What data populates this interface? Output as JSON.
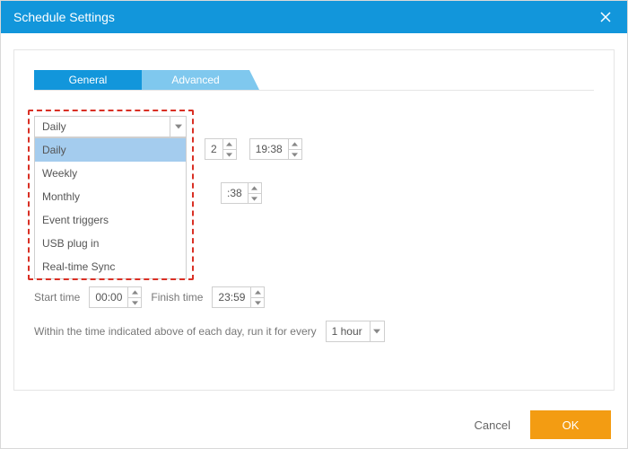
{
  "titlebar": {
    "title": "Schedule Settings"
  },
  "tabs": [
    {
      "label": "General",
      "active": true
    },
    {
      "label": "Advanced",
      "active": false
    }
  ],
  "frequency_select": {
    "value": "Daily",
    "options": [
      "Daily",
      "Weekly",
      "Monthly",
      "Event triggers",
      "USB plug in",
      "Real-time Sync"
    ],
    "selected_index": 0
  },
  "once_row": {
    "date_visible_fragment": "2",
    "time": "19:38"
  },
  "secondary_time": {
    "time_fragment": ":38"
  },
  "start_finish": {
    "start_label": "Start time",
    "start_value": "00:00",
    "finish_label": "Finish time",
    "finish_value": "23:59"
  },
  "interval": {
    "text": "Within the time indicated above of each day, run it for every",
    "value": "1 hour"
  },
  "footer": {
    "cancel": "Cancel",
    "ok": "OK"
  }
}
